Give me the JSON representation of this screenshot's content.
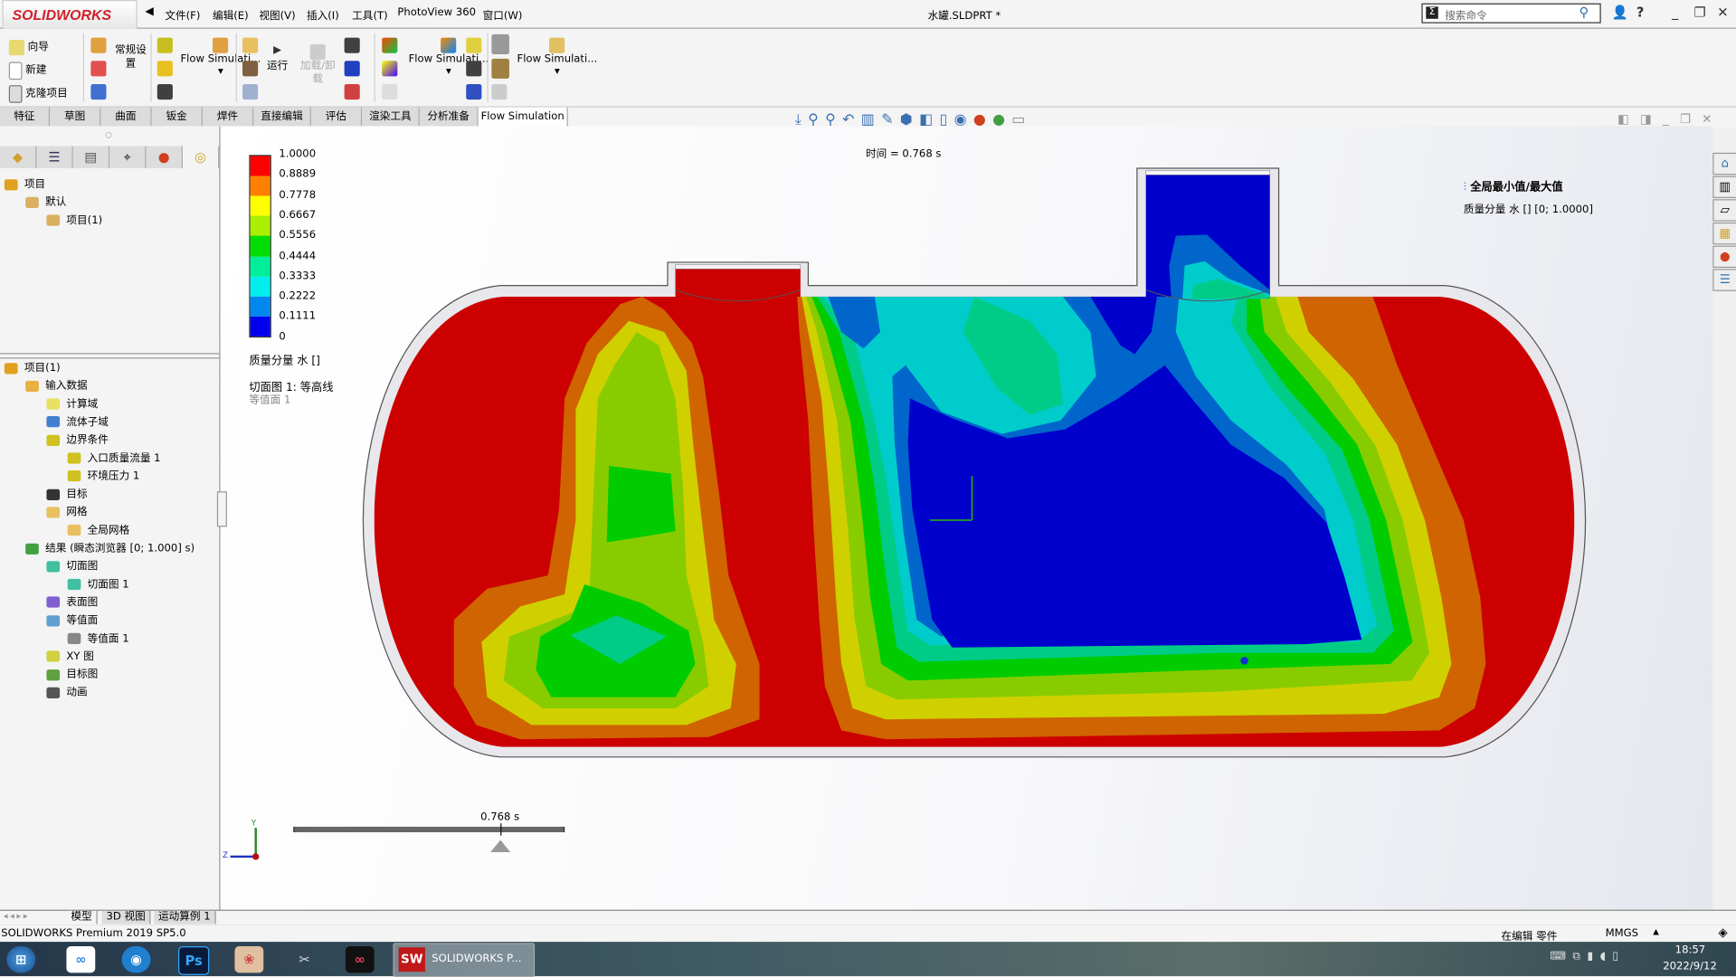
{
  "app": {
    "logo": "SOLIDWORKS",
    "document_title": "水罐.SLDPRT *"
  },
  "menu": [
    "文件(F)",
    "编辑(E)",
    "视图(V)",
    "插入(I)",
    "工具(T)",
    "PhotoView 360",
    "窗口(W)"
  ],
  "search": {
    "placeholder": "搜索命令"
  },
  "ribbon": {
    "wizard": "向导",
    "new": "新建",
    "clone": "克隆项目",
    "general_settings": "常规设置",
    "flow_sim_1": "Flow Simulati...",
    "run": "运行",
    "load_unload": "加载/卸载",
    "flow_sim_2": "Flow Simulati...",
    "flow_sim_3": "Flow Simulati..."
  },
  "tabs": [
    "特征",
    "草图",
    "曲面",
    "钣金",
    "焊件",
    "直接编辑",
    "评估",
    "渲染工具",
    "分析准备",
    "Flow Simulation"
  ],
  "active_tab": "Flow Simulation",
  "tree_top": [
    {
      "label": "项目",
      "level": 0
    },
    {
      "label": "默认",
      "level": 1
    },
    {
      "label": "项目(1)",
      "level": 2
    }
  ],
  "tree_bottom": [
    {
      "label": "项目(1)",
      "level": 0,
      "color": "#e0a020"
    },
    {
      "label": "输入数据",
      "level": 1,
      "color": "#e8b040"
    },
    {
      "label": "计算域",
      "level": 2,
      "color": "#e8e060"
    },
    {
      "label": "流体子域",
      "level": 2,
      "color": "#4080d0"
    },
    {
      "label": "边界条件",
      "level": 2,
      "color": "#d0c020"
    },
    {
      "label": "入口质量流量 1",
      "level": 3,
      "color": "#d0c020"
    },
    {
      "label": "环境压力 1",
      "level": 3,
      "color": "#d0c020"
    },
    {
      "label": "目标",
      "level": 2,
      "color": "#333333"
    },
    {
      "label": "网格",
      "level": 2,
      "color": "#e8c060"
    },
    {
      "label": "全局网格",
      "level": 3,
      "color": "#e8c060"
    },
    {
      "label": "结果 (瞬态浏览器 [0; 1.000] s)",
      "level": 1,
      "color": "#40a040"
    },
    {
      "label": "切面图",
      "level": 2,
      "color": "#40c0a0"
    },
    {
      "label": "切面图 1",
      "level": 3,
      "color": "#40c0a0"
    },
    {
      "label": "表面图",
      "level": 2,
      "color": "#8060d0"
    },
    {
      "label": "等值面",
      "level": 2,
      "color": "#60a0d0"
    },
    {
      "label": "等值面 1",
      "level": 3,
      "color": "#888888"
    },
    {
      "label": "XY 图",
      "level": 2,
      "color": "#d0d040"
    },
    {
      "label": "目标图",
      "level": 2,
      "color": "#60a040"
    },
    {
      "label": "动画",
      "level": 2,
      "color": "#555555"
    }
  ],
  "legend": {
    "values": [
      "1.0000",
      "0.8889",
      "0.7778",
      "0.6667",
      "0.5556",
      "0.4444",
      "0.3333",
      "0.2222",
      "0.1111",
      "0"
    ],
    "colors": [
      "#ff0000",
      "#ff7f00",
      "#ffff00",
      "#aaee00",
      "#00dd00",
      "#00ee99",
      "#00eeee",
      "#0088ee",
      "#0000ee"
    ],
    "parameter": "质量分量 水 []",
    "plot_name": "切面图 1: 等高线",
    "isosurface": "等值面 1"
  },
  "contour_colors": {
    "red": "#cc0000",
    "orange": "#d06400",
    "yellow": "#d0d000",
    "yellowgreen": "#88cc00",
    "green": "#00cc00",
    "seagreen": "#00cc88",
    "cyan": "#00cccc",
    "blue": "#0066cc",
    "darkblue": "#0000cc"
  },
  "viewport": {
    "time_label": "时间 = 0.768 s",
    "minmax_title": "全局最小值/最大值",
    "minmax_value": "质量分量 水 [] [0; 1.0000]",
    "timeline_label": "0.768 s",
    "timeline_progress": 0.768,
    "axis_y": "Y",
    "axis_z": "Z"
  },
  "bottom_tabs": [
    "模型",
    "3D 视图",
    "运动算例 1"
  ],
  "status": {
    "version": "SOLIDWORKS Premium 2019 SP5.0",
    "mode": "在编辑 零件",
    "units": "MMGS"
  },
  "taskbar": {
    "active_app": "SOLIDWORKS P...",
    "time": "18:57",
    "date": "2022/9/12"
  }
}
